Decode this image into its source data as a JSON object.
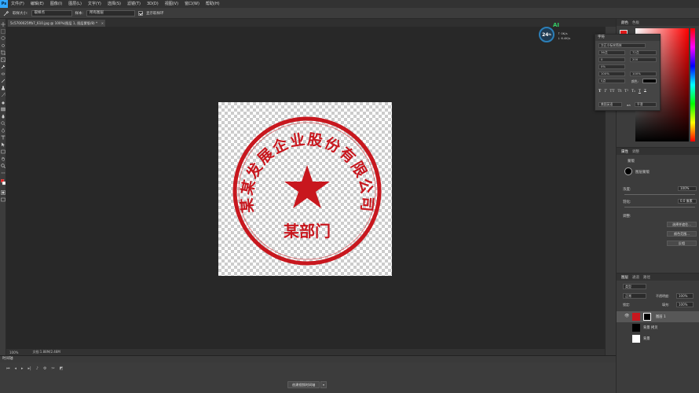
{
  "menubar": {
    "logo": "Ps",
    "items": [
      "文件(F)",
      "编辑(E)",
      "图像(I)",
      "图层(L)",
      "文字(Y)",
      "选择(S)",
      "滤镜(T)",
      "3D(D)",
      "视图(V)",
      "窗口(W)",
      "帮助(H)"
    ]
  },
  "options": {
    "tool_icon": "eyedropper-icon",
    "sample_size_label": "取样大小:",
    "sample_size_value": "取样点",
    "sample_label": "样本:",
    "sample_value": "所有图层",
    "show_ring_label": "显示取样环",
    "show_ring_checked": true
  },
  "document": {
    "tab_label": "5c5700025ffb7_610.jpg @ 100%(图层 1, 图层蒙版/8) *",
    "close": "×"
  },
  "stamp": {
    "ring_text": "某某发展企业股份有限公司",
    "department": "某部门",
    "color": "#c8171e"
  },
  "status": {
    "zoom": "100%",
    "doc_size": "文档:1.88M/2.48M"
  },
  "ai_overlay": {
    "badge": "24",
    "badge_unit": "%",
    "label": "AI",
    "stat1": "↑ 0K/s",
    "stat2": "↓ 6.4K/s"
  },
  "timeline": {
    "header": "时间轴",
    "create_button": "创建视频时间轴"
  },
  "color_panel": {
    "tabs": [
      "颜色",
      "色板"
    ],
    "foreground": "#e31b1b"
  },
  "character_panel": {
    "title": "字符",
    "font_family": "方正小标宋简体",
    "font_size": "36点",
    "leading": "72点",
    "kerning": "0",
    "tracking": "200",
    "scale_v": "0%",
    "scale_h": "100%",
    "vertical": "100%",
    "horizontal": "100%",
    "baseline": "0点",
    "color_label": "颜色:",
    "styles": [
      "T",
      "T",
      "TT",
      "Tt",
      "T¹",
      "T₁",
      "T",
      "T"
    ],
    "language": "美国英语",
    "aa_label": "aa",
    "aa_value": "平滑"
  },
  "properties": {
    "tabs": [
      "属性",
      "调整"
    ],
    "mask_label": "蒙版",
    "layer_mask_label": "图层蒙版",
    "density_label": "浓度:",
    "density_value": "100%",
    "feather_label": "羽化:",
    "feather_value": "0.0 像素",
    "refine_label": "调整:",
    "select_mask_button": "选择并遮住...",
    "color_range_button": "颜色范围...",
    "invert_button": "反相"
  },
  "layers": {
    "tabs": [
      "图层",
      "通道",
      "路径"
    ],
    "filter_label": "类型",
    "blend_mode": "正常",
    "opacity_label": "不透明度:",
    "opacity_value": "100%",
    "lock_label": "锁定:",
    "fill_label": "填充:",
    "fill_value": "100%",
    "rows": [
      {
        "name": "图层 1",
        "selected": true
      },
      {
        "name": "背景 拷贝",
        "selected": false
      },
      {
        "name": "背景",
        "selected": false
      }
    ]
  }
}
